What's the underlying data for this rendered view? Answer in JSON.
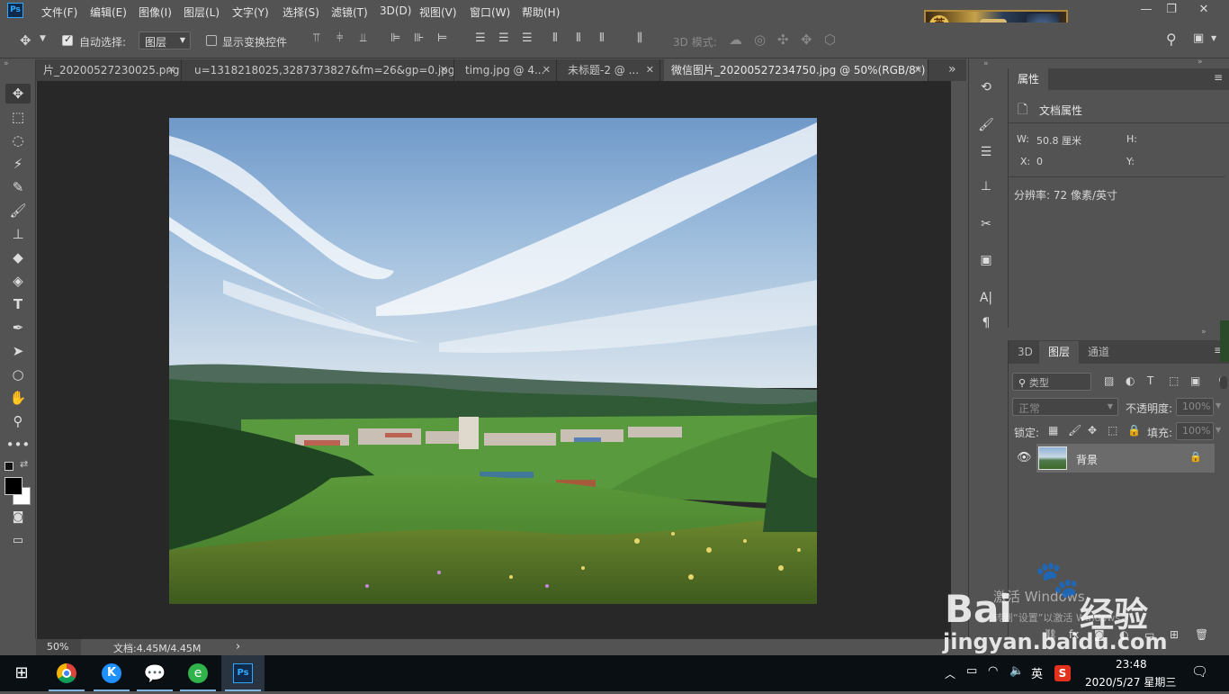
{
  "menu": {
    "items": [
      "文件(F)",
      "编辑(E)",
      "图像(I)",
      "图层(L)",
      "文字(Y)",
      "选择(S)",
      "滤镜(T)",
      "3D(D)",
      "视图(V)",
      "窗口(W)",
      "帮助(H)"
    ],
    "logo_text": "Ps"
  },
  "banner_text": "英",
  "options": {
    "auto_select_label": "自动选择:",
    "auto_select_value": "图层",
    "show_transform_label": "显示变换控件",
    "mode_3d_label": "3D 模式:"
  },
  "tabs": [
    {
      "label": "片_20200527230025.png"
    },
    {
      "label": "u=1318218025,3287373827&fm=26&gp=0.jpg"
    },
    {
      "label": "timg.jpg @ 4..."
    },
    {
      "label": "未标题-2 @ ..."
    },
    {
      "label": "微信图片_20200527234750.jpg @ 50%(RGB/8*)"
    }
  ],
  "tab_more_glyph": "»",
  "status": {
    "zoom": "50%",
    "doc": "文档:4.45M/4.45M",
    "arrow": "›"
  },
  "properties": {
    "title": "属性",
    "subtitle": "文档属性",
    "w_label": "W:",
    "w_value": "50.8 厘米",
    "h_label": "H:",
    "x_label": "X:",
    "x_value": "0",
    "y_label": "Y:",
    "resolution": "分辨率: 72 像素/英寸"
  },
  "layers": {
    "tabs": [
      "3D",
      "图层",
      "通道"
    ],
    "filter_placeholder": "类型",
    "blend_mode": "正常",
    "opacity_label": "不透明度:",
    "opacity_value": "100%",
    "lock_label": "锁定:",
    "fill_label": "填充:",
    "fill_value": "100%",
    "layer_name": "背景"
  },
  "watermark": {
    "activate": "激活 Windows",
    "goto": "转到“设置”以激活 Windows。",
    "baidu": "Bai",
    "baidu_suffix": "经验",
    "url": "jingyan.baidu.com"
  },
  "taskbar": {
    "time": "23:48",
    "date": "2020/5/27 星期三",
    "ime": "英"
  }
}
